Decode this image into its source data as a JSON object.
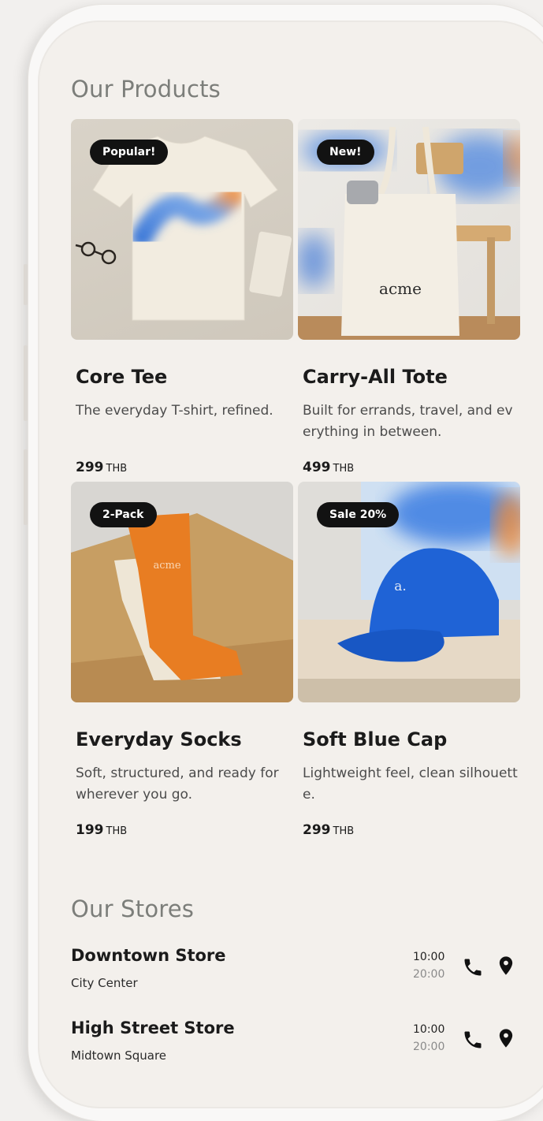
{
  "sections": {
    "products_title": "Our Products",
    "stores_title": "Our Stores"
  },
  "products": [
    {
      "badge": "Popular!",
      "name": "Core Tee",
      "description": "The everyday T-shirt, refined.",
      "price": "299",
      "currency": "THB"
    },
    {
      "badge": "New!",
      "name": "Carry-All Tote",
      "description": "Built for errands, travel, and everything in between.",
      "price": "499",
      "currency": "THB",
      "bag_text": "acme"
    },
    {
      "badge": "2-Pack",
      "name": "Everyday Socks",
      "description": "Soft, structured, and ready for wherever you go.",
      "price": "199",
      "currency": "THB",
      "sock_text": "acme"
    },
    {
      "badge": "Sale 20%",
      "name": "Soft Blue Cap",
      "description": "Lightweight feel, clean silhouette.",
      "price": "299",
      "currency": "THB",
      "cap_text": "a."
    }
  ],
  "stores": [
    {
      "name": "Downtown Store",
      "area": "City Center",
      "open": "10:00",
      "close": "20:00"
    },
    {
      "name": "High Street Store",
      "area": "Midtown Square",
      "open": "10:00",
      "close": "20:00"
    }
  ],
  "icons": {
    "phone": "phone-icon",
    "location": "location-pin-icon"
  },
  "colors": {
    "badge_bg": "#121212",
    "accent_blue": "#1f63d6",
    "accent_orange": "#e8822c",
    "screen_bg": "#f3f0ec"
  }
}
